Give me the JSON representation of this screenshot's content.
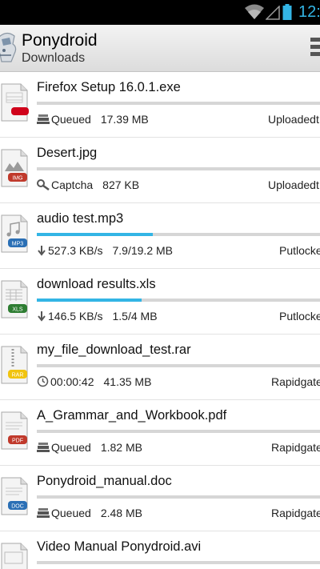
{
  "status_bar": {
    "time": "12:"
  },
  "action_bar": {
    "title": "Ponydroid",
    "subtitle": "Downloads"
  },
  "colors": {
    "accent": "#33b5e5",
    "progress_track": "#d6d6d6"
  },
  "downloads": [
    {
      "name": "Firefox Setup 16.0.1.exe",
      "file_type": "exe",
      "status_icon": "queue-icon",
      "status": "Queued",
      "detail": "17.39 MB",
      "host": "Uploadedt",
      "progress": 0
    },
    {
      "name": "Desert.jpg",
      "file_type": "IMG",
      "status_icon": "captcha-icon",
      "status": "Captcha",
      "detail": "827 KB",
      "host": "Uploadedt",
      "progress": 0
    },
    {
      "name": "audio test.mp3",
      "file_type": "MP3",
      "status_icon": "download-arrow-icon",
      "status": "527.3 KB/s",
      "detail": "7.9/19.2 MB",
      "host": "Putlocke",
      "progress": 0.41
    },
    {
      "name": "download results.xls",
      "file_type": "XLS",
      "status_icon": "download-arrow-icon",
      "status": "146.5 KB/s",
      "detail": "1.5/4 MB",
      "host": "Putlocke",
      "progress": 0.37
    },
    {
      "name": "my_file_download_test.rar",
      "file_type": "RAR",
      "status_icon": "clock-icon",
      "status": "00:00:42",
      "detail": "41.35 MB",
      "host": "Rapidgate",
      "progress": 0
    },
    {
      "name": "A_Grammar_and_Workbook.pdf",
      "file_type": "PDF",
      "status_icon": "queue-icon",
      "status": "Queued",
      "detail": "1.82 MB",
      "host": "Rapidgate",
      "progress": 0
    },
    {
      "name": "Ponydroid_manual.doc",
      "file_type": "DOC",
      "status_icon": "queue-icon",
      "status": "Queued",
      "detail": "2.48 MB",
      "host": "Rapidgate",
      "progress": 0
    },
    {
      "name": "Video Manual Ponydroid.avi",
      "file_type": "avi",
      "status_icon": "queue-icon",
      "status": "",
      "detail": "",
      "host": "",
      "progress": 0
    }
  ]
}
